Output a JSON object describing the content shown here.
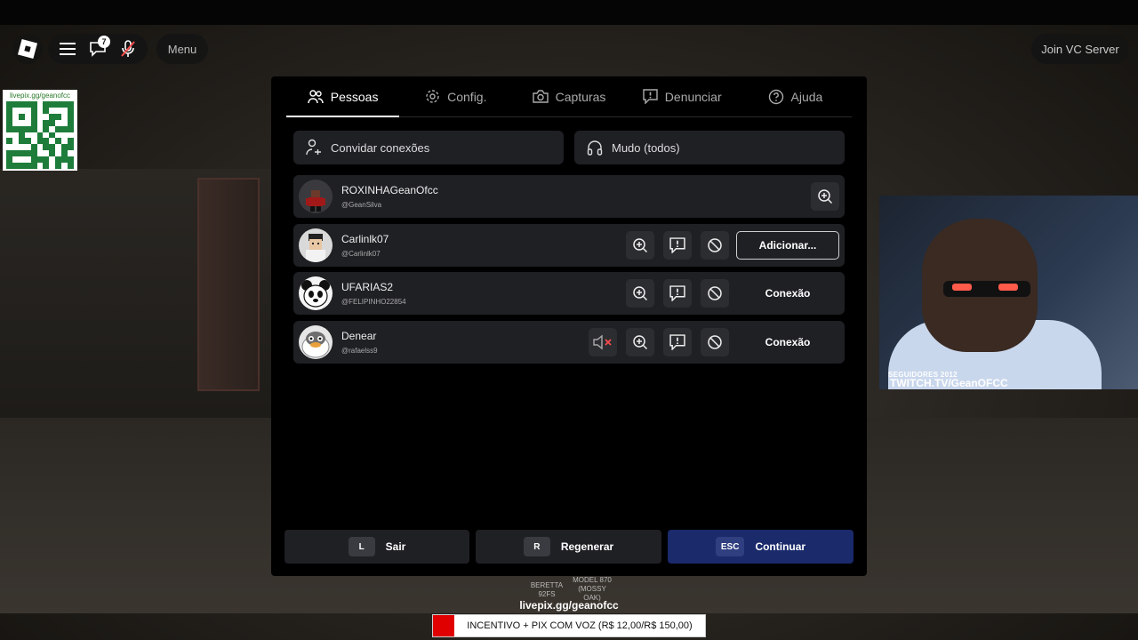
{
  "topbar": {
    "menu_label": "Menu",
    "notification_count": "7",
    "vc_button_label": "Join VC Server"
  },
  "qr": {
    "caption": "livepix.gg/geanofcc"
  },
  "tabs": [
    {
      "label": "Pessoas",
      "icon": "people-icon"
    },
    {
      "label": "Config.",
      "icon": "gear-icon"
    },
    {
      "label": "Capturas",
      "icon": "camera-icon"
    },
    {
      "label": "Denunciar",
      "icon": "report-icon"
    },
    {
      "label": "Ajuda",
      "icon": "help-icon"
    }
  ],
  "actions": {
    "invite_label": "Convidar conexões",
    "mute_label": "Mudo (todos)"
  },
  "players": [
    {
      "name": "ROXINHAGeanOfcc",
      "username": "@GeanSilva"
    },
    {
      "name": "Carlinlk07",
      "username": "@Carlinlk07",
      "action_label": "Adicionar..."
    },
    {
      "name": "UFARIAS2",
      "username": "@FELIPINHO22854",
      "action_label": "Conexão"
    },
    {
      "name": "Denear",
      "username": "@rafaelss9",
      "action_label": "Conexão"
    }
  ],
  "bottom": {
    "leave": {
      "key": "L",
      "label": "Sair"
    },
    "reset": {
      "key": "R",
      "label": "Regenerar"
    },
    "resume": {
      "key": "ESC",
      "label": "Continuar"
    }
  },
  "webcam": {
    "followers_text": "SEGUIDORES 2012",
    "channel_text": "TWITCH.TV/GeanOFCC"
  },
  "hud": {
    "weapon_1": "BERETTA 92FS",
    "weapon_2": "MODEL 870 (MOSSY OAK)",
    "livepix_text": "livepix.gg/geanofcc",
    "banner_text": "INCENTIVO + PIX COM VOZ (R$ 12,00/R$ 150,00)"
  },
  "colors": {
    "panel_bg": "#000000",
    "row_bg": "#1f2024",
    "primary_button": "#1a2a6b",
    "banner_accent": "#e00000"
  }
}
